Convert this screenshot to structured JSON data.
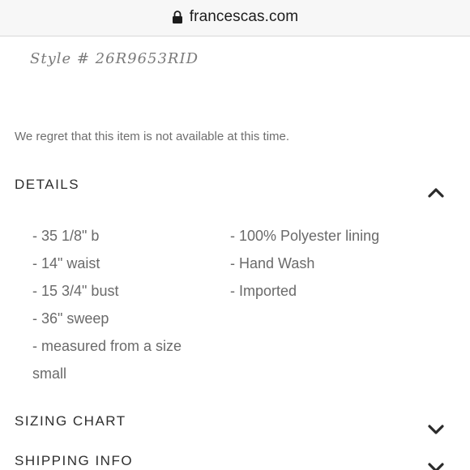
{
  "browser": {
    "url": "francescas.com",
    "lock_icon": "lock-icon"
  },
  "product": {
    "style_number": "Style # 26R9653RID",
    "availability_message": "We regret that this item is not available at this time."
  },
  "details": {
    "title": "DETAILS",
    "expanded": true,
    "left_items": [
      "- 35 1/8\" b",
      "- 14\" waist",
      "- 15 3/4\" bust",
      "- 36\" sweep",
      "- measured from a size",
      "small"
    ],
    "right_items": [
      "- 100% Polyester lining",
      "- Hand Wash",
      "- Imported"
    ]
  },
  "sizing_chart": {
    "title": "SIZING CHART",
    "expanded": false
  },
  "shipping_info": {
    "title": "SHIPPING INFO",
    "expanded": false
  },
  "colors": {
    "chevron": "#2a2a2a",
    "url_bar_bg": "#f7f7f7"
  }
}
